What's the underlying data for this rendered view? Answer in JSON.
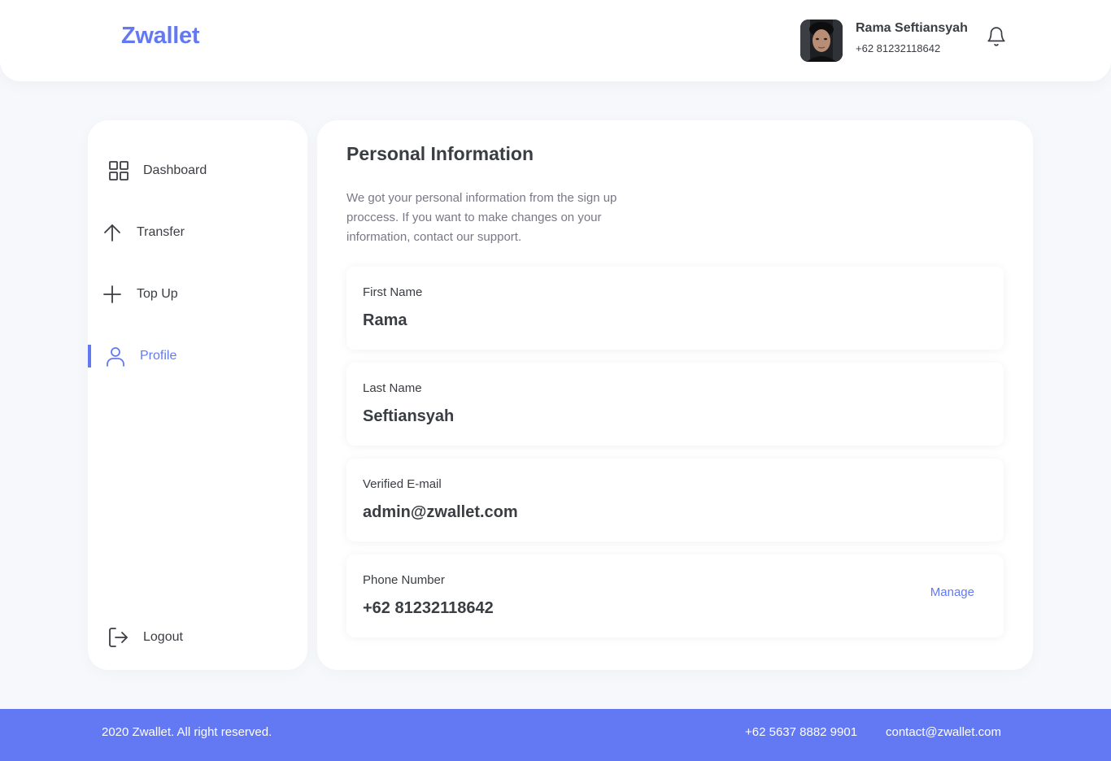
{
  "header": {
    "logo": "Zwallet",
    "user": {
      "name": "Rama Seftiansyah",
      "phone": "+62 81232118642",
      "avatar_icon": "user-avatar-photo"
    },
    "notification_icon": "bell-icon"
  },
  "sidebar": {
    "items": [
      {
        "label": "Dashboard",
        "icon": "grid-icon",
        "active": false
      },
      {
        "label": "Transfer",
        "icon": "arrow-up-icon",
        "active": false
      },
      {
        "label": "Top Up",
        "icon": "plus-icon",
        "active": false
      },
      {
        "label": "Profile",
        "icon": "user-icon",
        "active": true
      }
    ],
    "logout": {
      "label": "Logout",
      "icon": "logout-icon"
    }
  },
  "main": {
    "title": "Personal Information",
    "description": "We got your personal information from the sign up proccess. If you want to make changes on your information, contact our support.",
    "fields": [
      {
        "label": "First Name",
        "value": "Rama"
      },
      {
        "label": "Last Name",
        "value": "Seftiansyah"
      },
      {
        "label": "Verified E-mail",
        "value": "admin@zwallet.com"
      },
      {
        "label": "Phone Number",
        "value": "+62 81232118642",
        "action": "Manage"
      }
    ]
  },
  "footer": {
    "copyright": "2020 Zwallet. All right reserved.",
    "phone": "+62 5637 8882 9901",
    "email": "contact@zwallet.com"
  },
  "colors": {
    "accent": "#6379f4",
    "background": "#f7f8fc",
    "text": "#3a3d42",
    "muted": "#7a7886"
  }
}
